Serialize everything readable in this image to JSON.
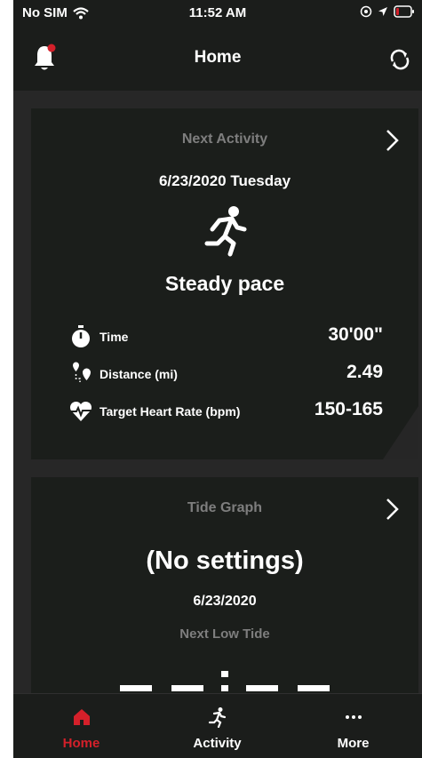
{
  "status_bar": {
    "carrier": "No SIM",
    "time": "11:52 AM"
  },
  "nav": {
    "title": "Home"
  },
  "next_activity": {
    "header": "Next Activity",
    "date": "6/23/2020 Tuesday",
    "activity_name": "Steady pace",
    "stats": [
      {
        "label": "Time",
        "value": "30'00\""
      },
      {
        "label": "Distance (mi)",
        "value": "2.49"
      },
      {
        "label": "Target Heart Rate (bpm)",
        "value": "150-165"
      }
    ]
  },
  "tide_graph": {
    "header": "Tide Graph",
    "status": "(No settings)",
    "date": "6/23/2020",
    "subtitle": "Next Low Tide"
  },
  "tabs": [
    {
      "label": "Home",
      "active": true,
      "color": "#d4202a"
    },
    {
      "label": "Activity",
      "active": false
    },
    {
      "label": "More",
      "active": false
    }
  ],
  "colors": {
    "accent": "#d4202a",
    "card_bg": "#1b1e1b",
    "muted_text": "#7e7e7e"
  }
}
